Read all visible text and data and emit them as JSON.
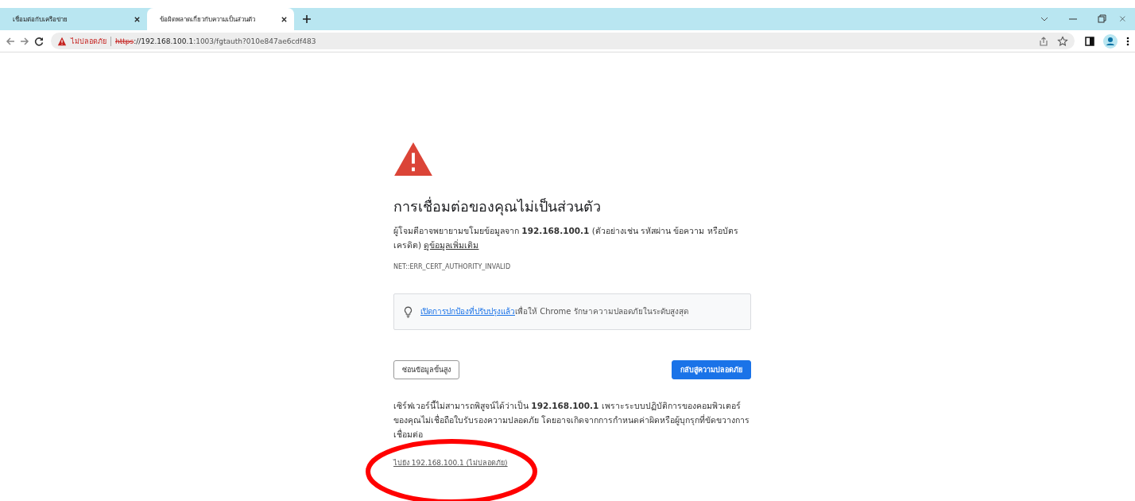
{
  "tabs": [
    {
      "title": "เชื่อมต่อกับเครือข่าย",
      "selected": false
    },
    {
      "title": "ข้อผิดพลาดเกี่ยวกับความเป็นส่วนตัว",
      "selected": true
    }
  ],
  "address_bar": {
    "security_label": "ไม่ปลอดภัย",
    "scheme": "https",
    "host": "://192.168.100.1",
    "rest": ":1003/fgtauth?010e847ae6cdf483"
  },
  "page": {
    "heading": "การเชื่อมต่อของคุณไม่เป็นส่วนตัว",
    "intro": "ผู้โจมตีอาจพยายามขโมยข้อมูลจาก **192.168.100.1** (ตัวอย่างเช่น รหัสผ่าน ข้อความ หรือบัตรเครดิต)",
    "learn_more": "ดูข้อมูลเพิ่มเติม",
    "error_code": "NET::ERR_CERT_AUTHORITY_INVALID",
    "tip_link": "เปิดการปกป้องที่ปรับปรุงแล้ว",
    "tip_text": "เพื่อให้ Chrome รักษาความปลอดภัยในระดับสูงสุด",
    "advanced_button": "ซ่อนข้อมูลขั้นสูง",
    "back_button": "กลับสู่ความปลอดภัย",
    "details": "เซิร์ฟเวอร์นี้ไม่สามารถพิสูจน์ได้ว่าเป็น **192.168.100.1** เพราะระบบปฏิบัติการของคอมพิวเตอร์ของคุณไม่เชื่อถือใบรับรองความปลอดภัย โดยอาจเกิดจากการกำหนดค่าผิดหรือผู้บุกรุกที่ขัดขวางการเชื่อมต่อ",
    "proceed_link": "ไปยัง 192.168.100.1 (ไม่ปลอดภัย)"
  },
  "annotation": {
    "kind": "ellipse"
  }
}
